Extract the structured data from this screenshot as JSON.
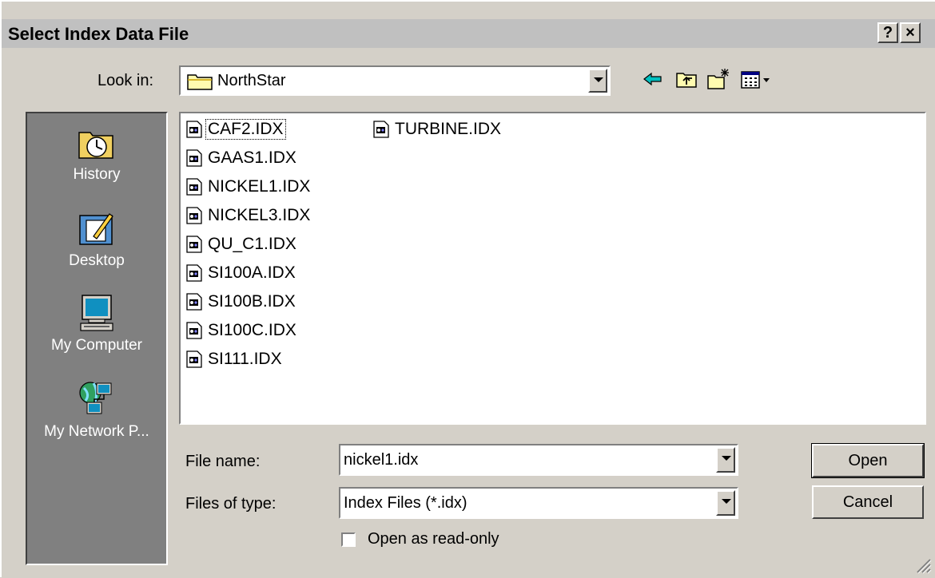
{
  "dialog": {
    "title": "Select Index Data File",
    "help_button": "?",
    "close_button": "×"
  },
  "lookin": {
    "label": "Look in:",
    "value": "NorthStar",
    "icon": "folder-icon"
  },
  "toolbar": {
    "icons": [
      "back-arrow-icon",
      "up-folder-icon",
      "new-folder-icon",
      "view-menu-icon"
    ]
  },
  "places": [
    {
      "label": "History",
      "icon": "history-icon"
    },
    {
      "label": "Desktop",
      "icon": "desktop-icon"
    },
    {
      "label": "My Computer",
      "icon": "my-computer-icon"
    },
    {
      "label": "My Network P...",
      "icon": "network-places-icon"
    }
  ],
  "files": {
    "column1": [
      "CAF2.IDX",
      "GAAS1.IDX",
      "NICKEL1.IDX",
      "NICKEL3.IDX",
      "QU_C1.IDX",
      "SI100A.IDX",
      "SI100B.IDX",
      "SI100C.IDX",
      "SI111.IDX"
    ],
    "column2": [
      "TURBINE.IDX"
    ]
  },
  "filename": {
    "label": "File name:",
    "value": "nickel1.idx"
  },
  "filetype": {
    "label": "Files of type:",
    "value": "Index Files (*.idx)"
  },
  "readonly": {
    "label": "Open as read-only",
    "checked": false
  },
  "buttons": {
    "open": "Open",
    "cancel": "Cancel"
  }
}
